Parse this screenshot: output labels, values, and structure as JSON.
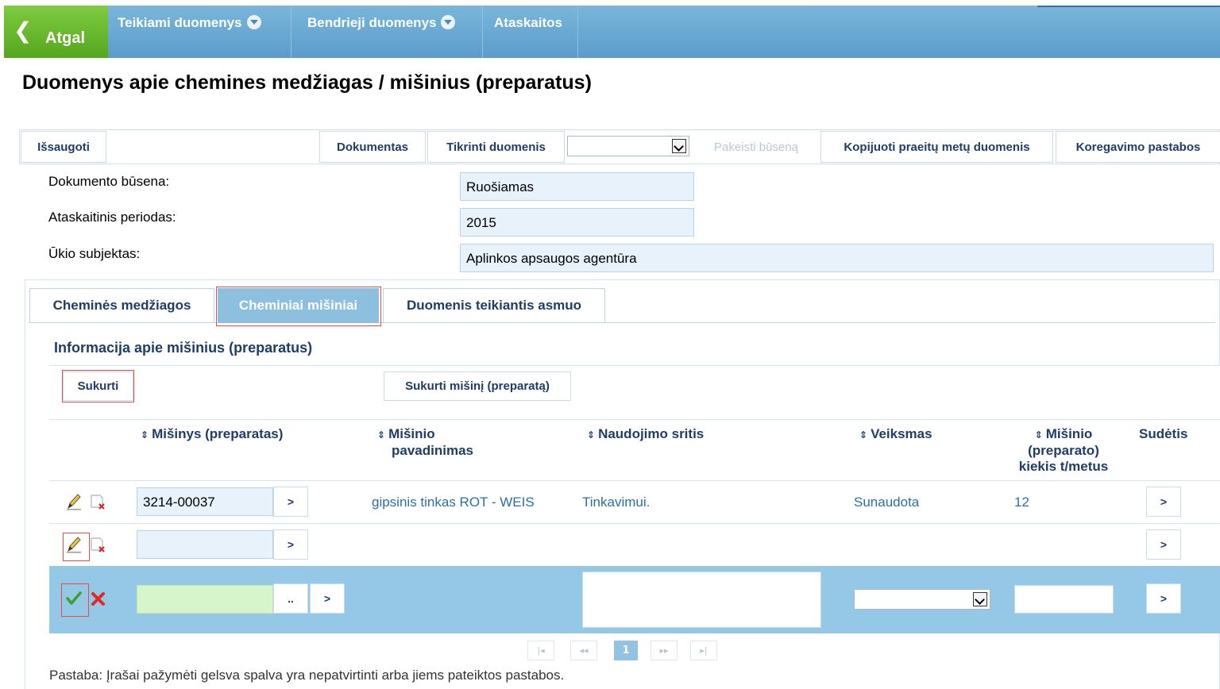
{
  "nav": {
    "back_label": "Atgal",
    "items": [
      {
        "label": "Teikiami duomenys",
        "has_dropdown": true
      },
      {
        "label": "Bendrieji duomenys",
        "has_dropdown": true
      },
      {
        "label": "Ataskaitos",
        "has_dropdown": false
      }
    ]
  },
  "page": {
    "title": "Duomenys apie chemines medžiagas / mišinius (preparatus)"
  },
  "toolbar": {
    "save": "Išsaugoti",
    "document": "Dokumentas",
    "check": "Tikrinti duomenis",
    "status_select_value": "",
    "change_status": "Pakeisti būseną",
    "copy_prev": "Kopijuoti praeitų metų duomenis",
    "correction_notes": "Koregavimo pastabos"
  },
  "info": {
    "status_label": "Dokumento būsena:",
    "status_value": "Ruošiamas",
    "period_label": "Ataskaitinis periodas:",
    "period_value": "2015",
    "entity_label": "Ūkio subjektas:",
    "entity_value": "Aplinkos apsaugos agentūra"
  },
  "tabs": [
    {
      "label": "Cheminės medžiagos",
      "active": false
    },
    {
      "label": "Cheminiai mišiniai",
      "active": true
    },
    {
      "label": "Duomenis teikiantis asmuo",
      "active": false
    }
  ],
  "section": {
    "title": "Informacija apie mišinius (preparatus)",
    "create": "Sukurti",
    "create_mixture": "Sukurti mišinį (preparatą)"
  },
  "grid": {
    "sort_icon": "⇕",
    "columns": {
      "mixture": "Mišinys (preparatas)",
      "name_1": "Mišinio",
      "name_2": "pavadinimas",
      "use": "Naudojimo sritis",
      "action": "Veiksmas",
      "qty_1": "Mišinio",
      "qty_2": "(preparato)",
      "qty_3": "kiekis t/metus",
      "composition": "Sudėtis"
    },
    "rows": [
      {
        "code": "3214-00037",
        "name": "gipsinis tinkas ROT - WEIS",
        "use": "Tinkavimui.",
        "action": "Sunaudota",
        "qty": "12"
      },
      {
        "code": "",
        "name": "",
        "use": "",
        "action": "",
        "qty": ""
      }
    ],
    "edit_row": {
      "code": "",
      "use": "",
      "action_select": "",
      "qty": ""
    },
    "go_label": ">",
    "lookup_label": ".."
  },
  "pager": {
    "first": "|◂",
    "prev": "◂◂",
    "current": "1",
    "next": "▸▸",
    "last": "▸|"
  },
  "note": "Pastaba: Įrašai pažymėti gelsva spalva yra nepatvirtinti arba jiems pateiktos pastabos.",
  "colors": {
    "nav_blue": "#6aaad6",
    "back_green": "#66b52c",
    "active_tab": "#8dc0de",
    "edit_row": "#94c8e6",
    "link_text": "#2c6fa3",
    "header_text": "#1f3d66",
    "highlight_red": "#e04c4c"
  }
}
